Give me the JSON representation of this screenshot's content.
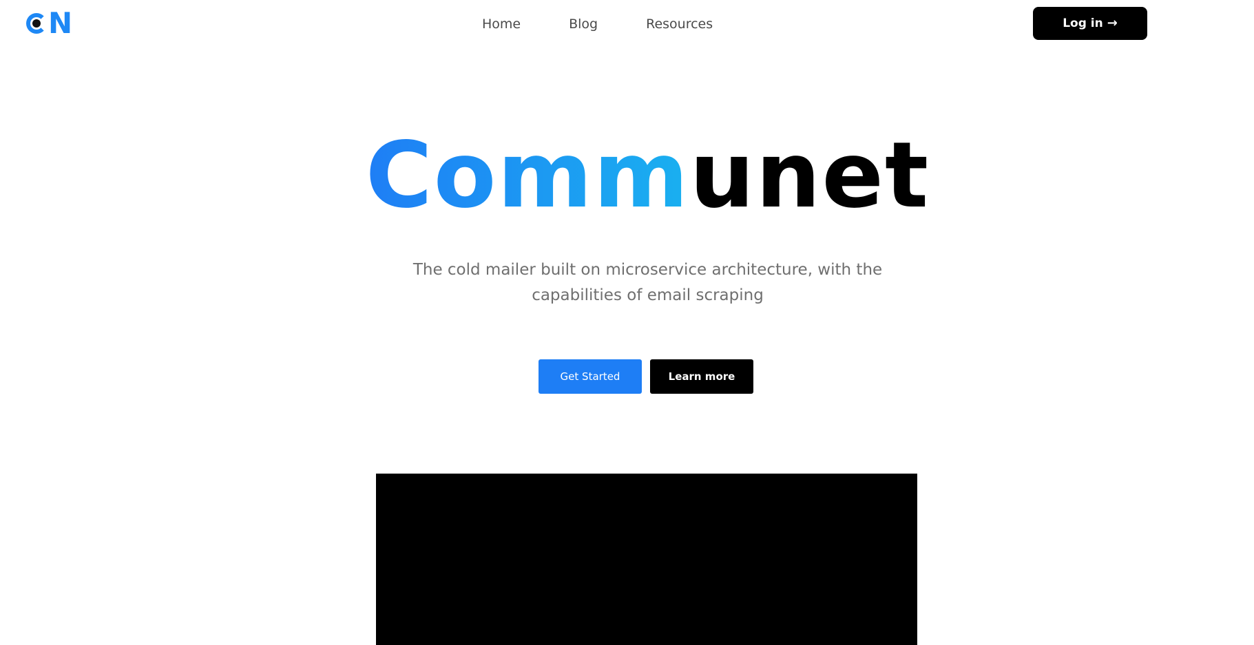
{
  "header": {
    "logo": {
      "letter_c": "C",
      "letter_n": "N"
    },
    "nav": [
      {
        "label": "Home"
      },
      {
        "label": "Blog"
      },
      {
        "label": "Resources"
      }
    ],
    "login": {
      "label": "Log in",
      "icon": "arrow-right-icon"
    }
  },
  "hero": {
    "title_blue": "Comm",
    "title_black": "unet",
    "subtitle_line1": "The cold mailer built on microservice architecture, with the",
    "subtitle_line2": "capabilities of email scraping",
    "get_started": "Get Started",
    "learn_more": "Learn more"
  },
  "colors": {
    "accent": "#1e7ef5",
    "accent_light": "#1ab0f0",
    "dark": "#000000",
    "text_muted": "#6f6f6f"
  }
}
